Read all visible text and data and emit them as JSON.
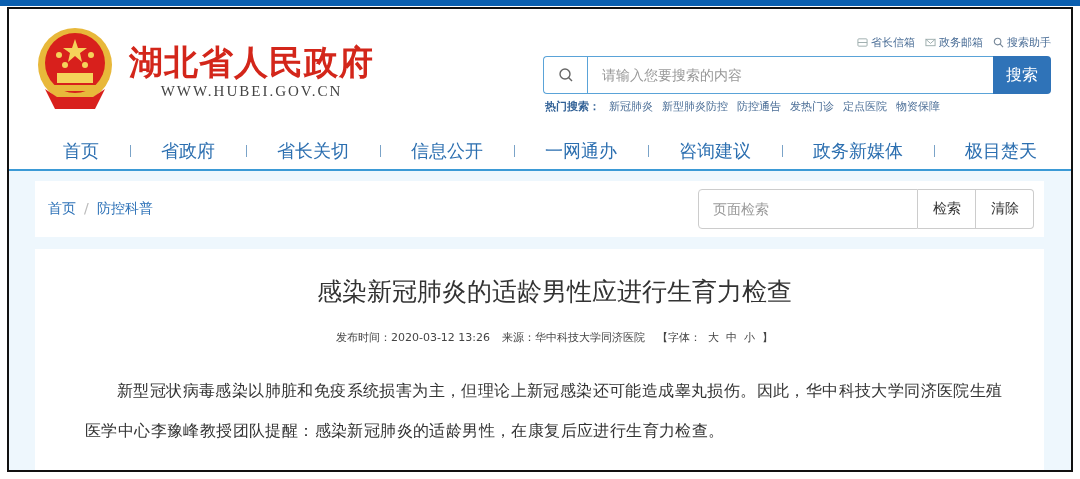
{
  "header": {
    "site_title": "湖北省人民政府",
    "site_url": "WWW.HUBEI.GOV.CN",
    "top_links": [
      {
        "label": "省长信箱",
        "kind": "inbox"
      },
      {
        "label": "政务邮箱",
        "kind": "mail"
      },
      {
        "label": "搜索助手",
        "kind": "search"
      }
    ],
    "search": {
      "placeholder": "请输入您要搜索的内容",
      "button": "搜索"
    },
    "hot_search": {
      "label": "热门搜索：",
      "items": [
        "新冠肺炎",
        "新型肺炎防控",
        "防控通告",
        "发热门诊",
        "定点医院",
        "物资保障"
      ]
    }
  },
  "nav": {
    "items": [
      "首页",
      "省政府",
      "省长关切",
      "信息公开",
      "一网通办",
      "咨询建议",
      "政务新媒体",
      "极目楚天"
    ]
  },
  "breadcrumb": {
    "items": [
      "首页",
      "防控科普"
    ],
    "separator": "/"
  },
  "page_search": {
    "placeholder": "页面检索",
    "buttons": [
      "检索",
      "清除"
    ]
  },
  "article": {
    "title": "感染新冠肺炎的适龄男性应进行生育力检查",
    "meta": {
      "published": "发布时间：2020-03-12 13:26",
      "source": "来源：华中科技大学同济医院",
      "font_label": "【字体：",
      "font_sizes": [
        "大",
        "中",
        "小"
      ],
      "font_close": "】"
    },
    "paragraphs": [
      "新型冠状病毒感染以肺脏和免疫系统损害为主，但理论上新冠感染还可能造成睾丸损伤。因此，华中科技大学同济医院生殖医学中心李豫峰教授团队提醒：感染新冠肺炎的适龄男性，在康复后应进行生育力检查。"
    ]
  }
}
